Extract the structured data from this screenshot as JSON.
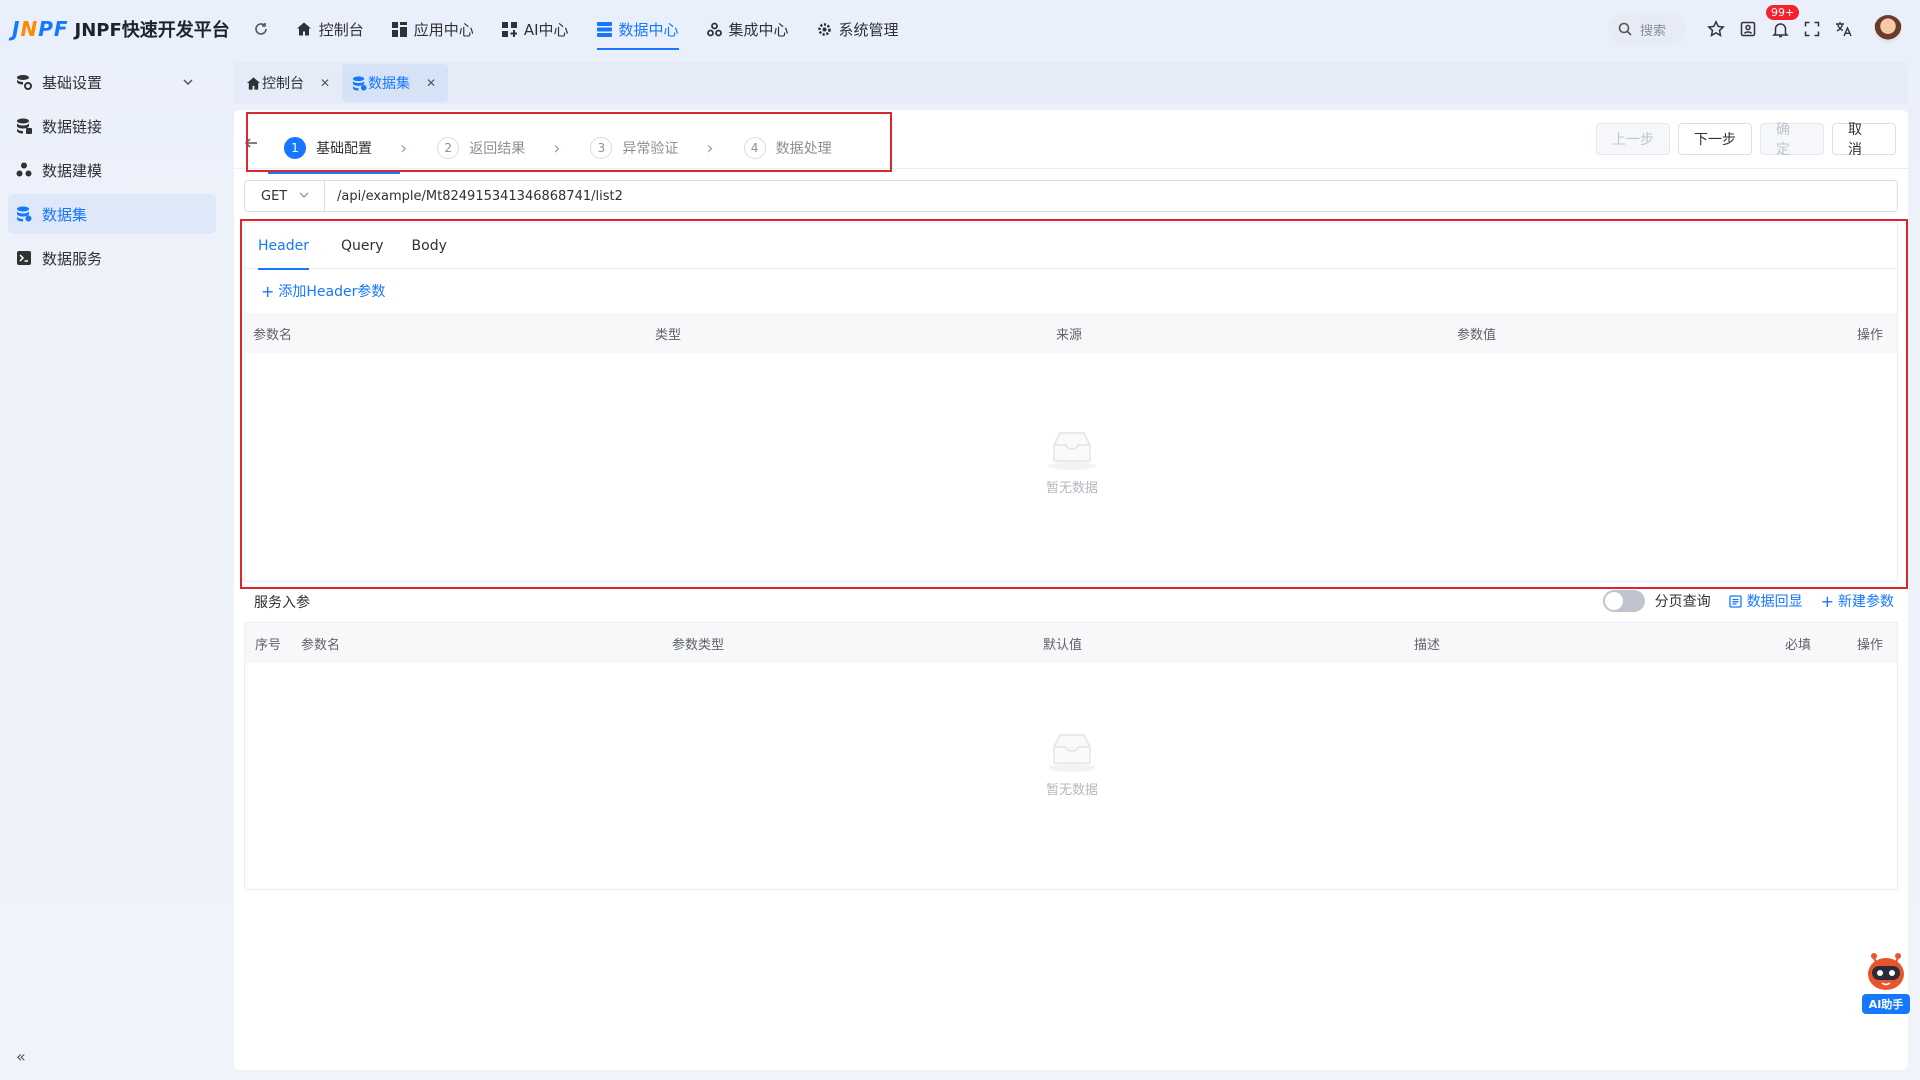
{
  "app": {
    "logo_mark": "JNPF",
    "title": "JNPF快速开发平台"
  },
  "nav": [
    {
      "label": "控制台",
      "icon": "home-icon"
    },
    {
      "label": "应用中心",
      "icon": "grid-icon"
    },
    {
      "label": "AI中心",
      "icon": "ai-grid-icon"
    },
    {
      "label": "数据中心",
      "icon": "database-icon",
      "active": true
    },
    {
      "label": "集成中心",
      "icon": "integration-icon"
    },
    {
      "label": "系统管理",
      "icon": "gear-icon"
    }
  ],
  "topbar": {
    "search_placeholder": "搜索",
    "notification_badge": "99+"
  },
  "sidebar": {
    "items": [
      {
        "label": "基础设置",
        "icon": "settings-db-icon"
      },
      {
        "label": "数据链接",
        "icon": "link-db-icon"
      },
      {
        "label": "数据建模",
        "icon": "model-icon"
      },
      {
        "label": "数据集",
        "icon": "dataset-icon",
        "active": true
      },
      {
        "label": "数据服务",
        "icon": "service-icon"
      }
    ],
    "collapse": "«"
  },
  "tabs": [
    {
      "label": "控制台",
      "icon": "home-icon"
    },
    {
      "label": "数据集",
      "icon": "dataset-icon",
      "active": true
    }
  ],
  "steps": [
    {
      "num": "1",
      "label": "基础配置",
      "active": true
    },
    {
      "num": "2",
      "label": "返回结果"
    },
    {
      "num": "3",
      "label": "异常验证"
    },
    {
      "num": "4",
      "label": "数据处理"
    }
  ],
  "buttons": {
    "prev": "上一步",
    "next": "下一步",
    "confirm": "确 定",
    "cancel": "取 消"
  },
  "request": {
    "method": "GET",
    "url": "/api/example/Mt824915341346868741/list2"
  },
  "param_tabs": [
    "Header",
    "Query",
    "Body"
  ],
  "header_params": {
    "add_label": "添加Header参数",
    "columns": [
      "参数名",
      "类型",
      "来源",
      "参数值",
      "操作"
    ],
    "rows": [],
    "empty_text": "暂无数据"
  },
  "service_params": {
    "title": "服务入参",
    "paging_label": "分页查询",
    "paging_on": false,
    "echo_label": "数据回显",
    "new_label": "新建参数",
    "columns": [
      "序号",
      "参数名",
      "参数类型",
      "默认值",
      "描述",
      "必填",
      "操作"
    ],
    "rows": [],
    "empty_text": "暂无数据"
  },
  "ai_helper": {
    "label": "AI助手"
  },
  "colors": {
    "accent": "#1677ff",
    "highlight_border": "#d9272e",
    "badge": "#f5222d"
  }
}
